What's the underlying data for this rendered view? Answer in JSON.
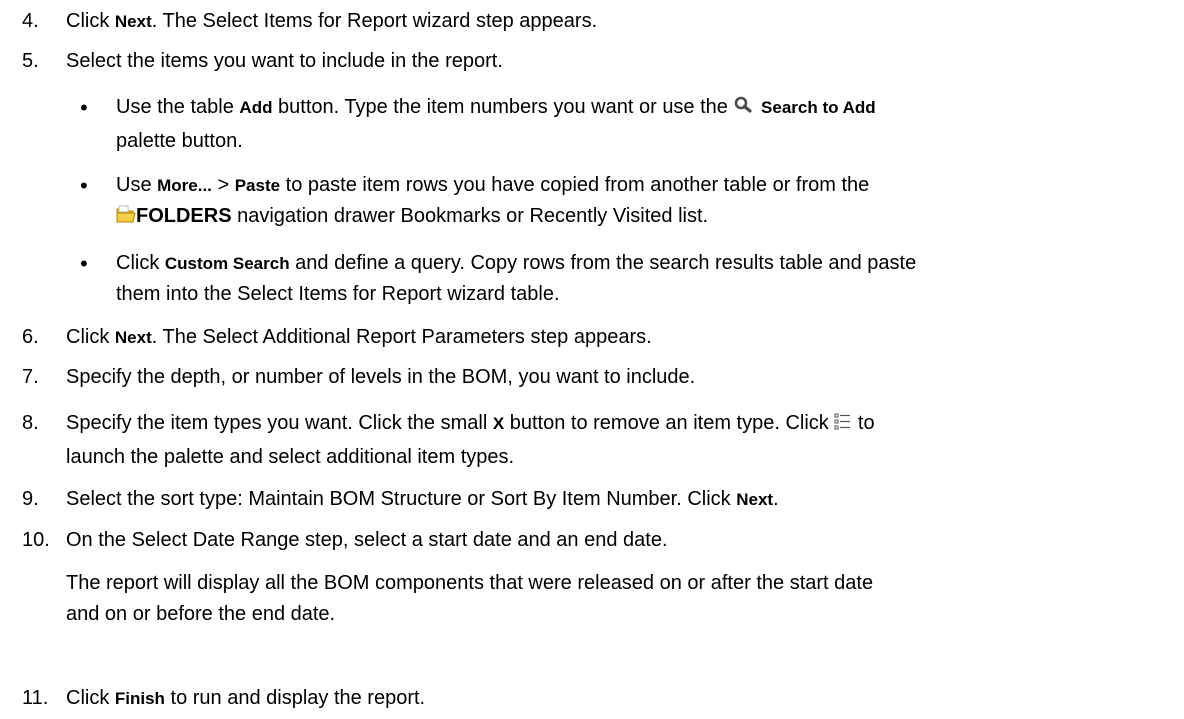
{
  "steps": [
    {
      "number": "4.",
      "parts": [
        "Click ",
        "Next",
        ". The Select Items for Report wizard step appears."
      ]
    },
    {
      "number": "5.",
      "text": "Select the items you want to include in the report.",
      "bullets": [
        {
          "parts": [
            "Use the table ",
            "Add",
            " button. Type the item numbers you want or use the ",
            "Search to Add",
            "palette button."
          ]
        },
        {
          "parts": [
            "Use ",
            "More...",
            " > ",
            "Paste",
            " to paste item rows you have copied from another table or from the",
            "FOLDERS",
            " navigation drawer Bookmarks or Recently Visited list."
          ]
        },
        {
          "parts": [
            "Click ",
            "Custom Search",
            " and define a query. Copy rows from the search results table and paste",
            "them into the Select Items for Report wizard table."
          ]
        }
      ]
    },
    {
      "number": "6.",
      "parts": [
        "Click ",
        "Next",
        ". The Select Additional Report Parameters step appears."
      ]
    },
    {
      "number": "7.",
      "text": "Specify the depth, or number of levels in the BOM, you want to include."
    },
    {
      "number": "8.",
      "parts": [
        "Specify the item types you want. Click the small ",
        "X",
        " button to remove an item type. Click ",
        " to",
        "launch the palette and select additional item types."
      ]
    },
    {
      "number": "9.",
      "parts": [
        "Select the sort type: Maintain BOM Structure or Sort By Item Number. Click ",
        "Next",
        "."
      ]
    },
    {
      "number": "10.",
      "text": "On the Select Date Range step, select a start date and an end date.",
      "paragraph": [
        "The report will display all the BOM components that were released on or after the start date",
        "and on or before the end date."
      ]
    },
    {
      "number": "11.",
      "parts": [
        "Click ",
        "Finish",
        " to run and display the report."
      ]
    }
  ],
  "icons": {
    "search": "magnifier-icon",
    "folders": "folder-icon",
    "palette": "list-palette-icon"
  },
  "colors": {
    "text": "#000000",
    "folder": "#e8b400",
    "search_icon": "#4a4a4a"
  }
}
